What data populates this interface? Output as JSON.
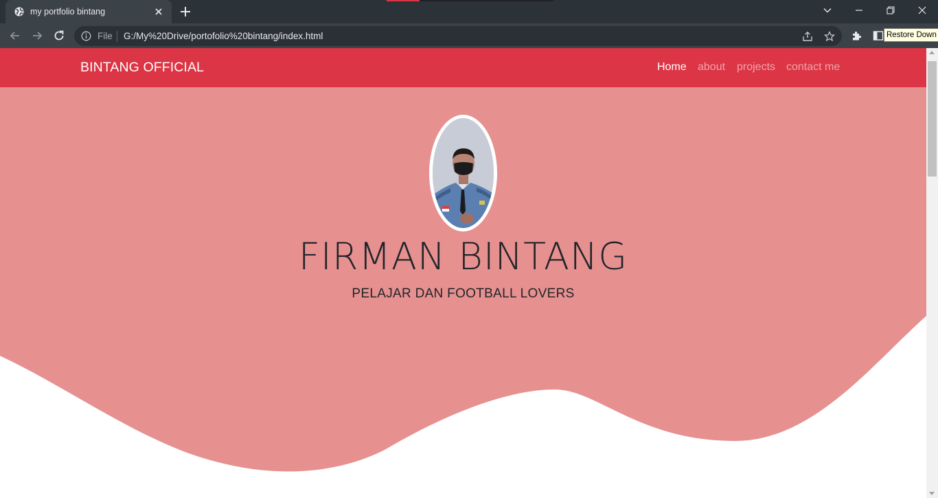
{
  "browser": {
    "tab_title": "my portfolio bintang",
    "file_label": "File",
    "url": "G:/My%20Drive/portofolio%20bintang/index.html",
    "tooltip": "Restore Down"
  },
  "site": {
    "brand": "BINTANG OFFICIAL",
    "nav": [
      {
        "label": "Home",
        "active": true
      },
      {
        "label": "about",
        "active": false
      },
      {
        "label": "projects",
        "active": false
      },
      {
        "label": "contact me",
        "active": false
      }
    ],
    "hero_name": "FIRMAN BINTANG",
    "hero_subtitle": "PELAJAR DAN FOOTBALL LOVERS"
  },
  "colors": {
    "navbar": "#dc3545",
    "hero": "#e69090",
    "chrome_dark": "#2b3238",
    "chrome_toolbar": "#3c4348"
  },
  "icons": {
    "tab_favicon": "globe-icon",
    "tab_close": "close-icon",
    "new_tab": "plus-icon",
    "back": "arrow-left-icon",
    "forward": "arrow-right-icon",
    "reload": "reload-icon",
    "site_info": "info-icon",
    "share": "share-icon",
    "bookmark": "star-icon",
    "extensions": "puzzle-icon",
    "side_panel": "side-panel-icon"
  }
}
